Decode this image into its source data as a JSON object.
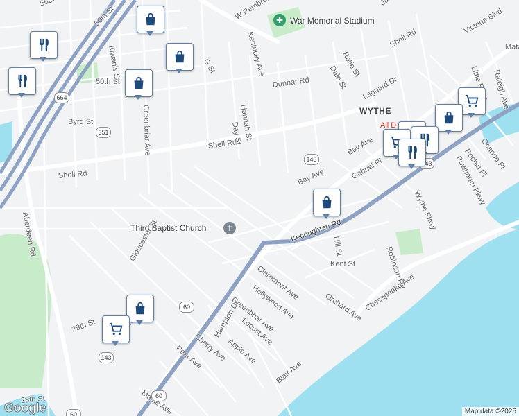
{
  "map": {
    "colors": {
      "land": "#f1f3f4",
      "water": "#9ee0ef",
      "park": "#c8ebc9",
      "road": "#ffffff",
      "highway": "#8ea2c3",
      "marker_border": "#5f7fa8",
      "marker_icon": "#1e4a7a",
      "poi_green": "#2e9e6a"
    },
    "area_label": "WYTHE",
    "places": {
      "stadium": "War Memorial Stadium",
      "church": "Third Baptist Church",
      "partial_place": "All D"
    },
    "streets": [
      "56th St",
      "50th St",
      "Kiwanis St",
      "50th St",
      "Byrd St",
      "Shell Rd",
      "Shell Rd",
      "Aberdeen Rd",
      "Greenbriar Ave",
      "G St",
      "Kentucky Ave",
      "W Pembroke",
      "Hannah St",
      "Day St",
      "Dunbar Rd",
      "Dale St",
      "Rolfe St",
      "Shell Rd",
      "Laguard Dr",
      "Victoria Blvd",
      "Bay Ave",
      "Gabriel Pl",
      "Kecoughtan Rd",
      "Wythe Pkwy",
      "Little Farm",
      "Raleigh Ave",
      "Powhatan Pkwy",
      "Pochin Pl",
      "Ocanoe Pl",
      "Bay Ave",
      "Hill St",
      "Robinson Rd",
      "Kent St",
      "Claremont Ave",
      "Hollywood Ave",
      "Greenbriar Ave",
      "Orchard Ave",
      "Chesapeake Ave",
      "Gloucester St",
      "Victoria Blvd",
      "Hampton Dr",
      "Locust Ave",
      "Apple Ave",
      "Cherry Ave",
      "Pear Ave",
      "Maple Ave",
      "Blair Ave",
      "29th St",
      "28th St",
      "James",
      "Mata"
    ],
    "shields": [
      "664",
      "351",
      "143",
      "143",
      "60",
      "143",
      "60",
      "60"
    ],
    "markers": [
      "shopping-bag",
      "restaurant",
      "shopping-bag",
      "restaurant",
      "shopping-bag",
      "shopping-cart",
      "shopping-bag",
      "shopping-cart",
      "restaurant",
      "shopping-cart",
      "restaurant",
      "shopping-bag",
      "shopping-bag",
      "shopping-cart"
    ],
    "attribution": "Map data ©2025",
    "logo": "Google"
  }
}
